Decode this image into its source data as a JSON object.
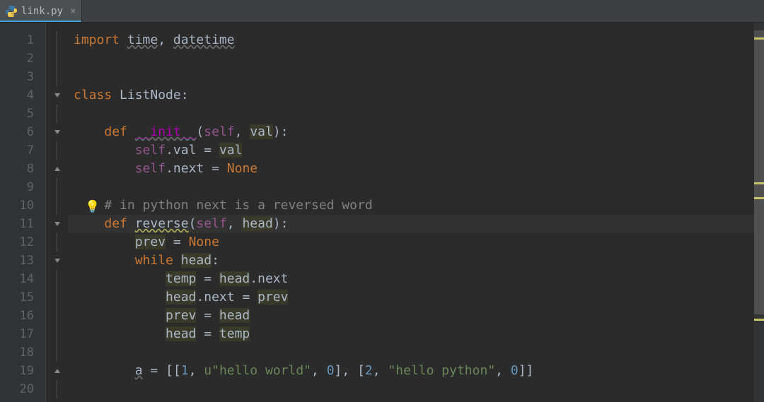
{
  "tab": {
    "filename": "link.py",
    "active": true
  },
  "editor": {
    "current_line": 11,
    "lines": [
      {
        "n": 1,
        "indent": 0,
        "fold": "line",
        "tokens": [
          {
            "t": "import ",
            "c": "kw"
          },
          {
            "t": "time",
            "c": "wavy"
          },
          {
            "t": ", ",
            "c": "punct"
          },
          {
            "t": "datetime",
            "c": "wavy"
          }
        ]
      },
      {
        "n": 2,
        "indent": 0,
        "fold": "line",
        "tokens": []
      },
      {
        "n": 3,
        "indent": 0,
        "fold": "line",
        "tokens": []
      },
      {
        "n": 4,
        "indent": 0,
        "fold": "open",
        "tokens": [
          {
            "t": "class ",
            "c": "kw"
          },
          {
            "t": "ListNode",
            "c": ""
          },
          {
            "t": ":",
            "c": "punct"
          }
        ]
      },
      {
        "n": 5,
        "indent": 0,
        "fold": "line",
        "tokens": []
      },
      {
        "n": 6,
        "indent": 1,
        "fold": "open",
        "tokens": [
          {
            "t": "def ",
            "c": "kw"
          },
          {
            "t": "__init__",
            "c": "dunder wavy"
          },
          {
            "t": "(",
            "c": "punct"
          },
          {
            "t": "self",
            "c": "self"
          },
          {
            "t": ", ",
            "c": "punct"
          },
          {
            "t": "val",
            "c": "id-hi"
          },
          {
            "t": ")",
            "c": "punct"
          },
          {
            "t": ":",
            "c": "punct"
          }
        ]
      },
      {
        "n": 7,
        "indent": 2,
        "fold": "line",
        "tokens": [
          {
            "t": "self",
            "c": "self"
          },
          {
            "t": ".",
            "c": "punct"
          },
          {
            "t": "val",
            "c": ""
          },
          {
            "t": " = ",
            "c": "punct"
          },
          {
            "t": "val",
            "c": "id-hi"
          }
        ]
      },
      {
        "n": 8,
        "indent": 2,
        "fold": "close",
        "tokens": [
          {
            "t": "self",
            "c": "self"
          },
          {
            "t": ".",
            "c": "punct"
          },
          {
            "t": "next",
            "c": ""
          },
          {
            "t": " = ",
            "c": "punct"
          },
          {
            "t": "None",
            "c": "const"
          }
        ]
      },
      {
        "n": 9,
        "indent": 0,
        "fold": "line",
        "tokens": []
      },
      {
        "n": 10,
        "indent": 1,
        "fold": "line",
        "bulb": true,
        "tokens": [
          {
            "t": "# in python next is a reversed word",
            "c": "cmt"
          }
        ]
      },
      {
        "n": 11,
        "indent": 1,
        "fold": "open",
        "current": true,
        "tokens": [
          {
            "t": "def ",
            "c": "kw"
          },
          {
            "t": "reverse",
            "c": "wavy-warn"
          },
          {
            "t": "(",
            "c": "punct"
          },
          {
            "t": "self",
            "c": "self"
          },
          {
            "t": ", ",
            "c": "punct"
          },
          {
            "t": "head",
            "c": "id-hi"
          },
          {
            "t": ")",
            "c": "punct"
          },
          {
            "t": ":",
            "c": "punct"
          }
        ]
      },
      {
        "n": 12,
        "indent": 2,
        "fold": "line",
        "tokens": [
          {
            "t": "prev",
            "c": "id-hi"
          },
          {
            "t": " = ",
            "c": "punct"
          },
          {
            "t": "None",
            "c": "const"
          }
        ]
      },
      {
        "n": 13,
        "indent": 2,
        "fold": "open",
        "tokens": [
          {
            "t": "while ",
            "c": "kw"
          },
          {
            "t": "head",
            "c": "id-hi"
          },
          {
            "t": ":",
            "c": "punct"
          }
        ]
      },
      {
        "n": 14,
        "indent": 3,
        "fold": "line",
        "tokens": [
          {
            "t": "temp",
            "c": "id-hi"
          },
          {
            "t": " = ",
            "c": "punct"
          },
          {
            "t": "head",
            "c": "id-hi"
          },
          {
            "t": ".",
            "c": "punct"
          },
          {
            "t": "next",
            "c": ""
          }
        ]
      },
      {
        "n": 15,
        "indent": 3,
        "fold": "line",
        "tokens": [
          {
            "t": "head",
            "c": "id-hi"
          },
          {
            "t": ".",
            "c": "punct"
          },
          {
            "t": "next",
            "c": ""
          },
          {
            "t": " = ",
            "c": "punct"
          },
          {
            "t": "prev",
            "c": "id-hi"
          }
        ]
      },
      {
        "n": 16,
        "indent": 3,
        "fold": "line",
        "tokens": [
          {
            "t": "prev",
            "c": "id-hi"
          },
          {
            "t": " = ",
            "c": "punct"
          },
          {
            "t": "head",
            "c": "id-hi"
          }
        ]
      },
      {
        "n": 17,
        "indent": 3,
        "fold": "line",
        "tokens": [
          {
            "t": "head",
            "c": "id-hi"
          },
          {
            "t": " = ",
            "c": "punct"
          },
          {
            "t": "temp",
            "c": "id-hi"
          }
        ]
      },
      {
        "n": 18,
        "indent": 0,
        "fold": "line",
        "tokens": []
      },
      {
        "n": 19,
        "indent": 2,
        "fold": "close",
        "tokens": [
          {
            "t": "a",
            "c": "wavy"
          },
          {
            "t": " = ",
            "c": "punct"
          },
          {
            "t": "[[",
            "c": "punct"
          },
          {
            "t": "1",
            "c": "num"
          },
          {
            "t": ", ",
            "c": "punct"
          },
          {
            "t": "u\"hello world\"",
            "c": "str"
          },
          {
            "t": ", ",
            "c": "punct"
          },
          {
            "t": "0",
            "c": "num"
          },
          {
            "t": "]",
            "c": "punct"
          },
          {
            "t": ", ",
            "c": "punct"
          },
          {
            "t": "[",
            "c": "punct"
          },
          {
            "t": "2",
            "c": "num"
          },
          {
            "t": ", ",
            "c": "punct"
          },
          {
            "t": "\"hello python\"",
            "c": "str"
          },
          {
            "t": ", ",
            "c": "punct"
          },
          {
            "t": "0",
            "c": "num"
          },
          {
            "t": "]]",
            "c": "punct"
          }
        ]
      },
      {
        "n": 20,
        "indent": 0,
        "fold": "line",
        "tokens": []
      }
    ]
  },
  "stripe": {
    "thumb": {
      "top_pct": 2,
      "height_pct": 75
    },
    "ticks": [
      {
        "top_pct": 4,
        "color": "#c9c56b"
      },
      {
        "top_pct": 42,
        "color": "#c9c56b"
      },
      {
        "top_pct": 46,
        "color": "#c9c56b"
      },
      {
        "top_pct": 78,
        "color": "#c9c56b"
      }
    ]
  }
}
